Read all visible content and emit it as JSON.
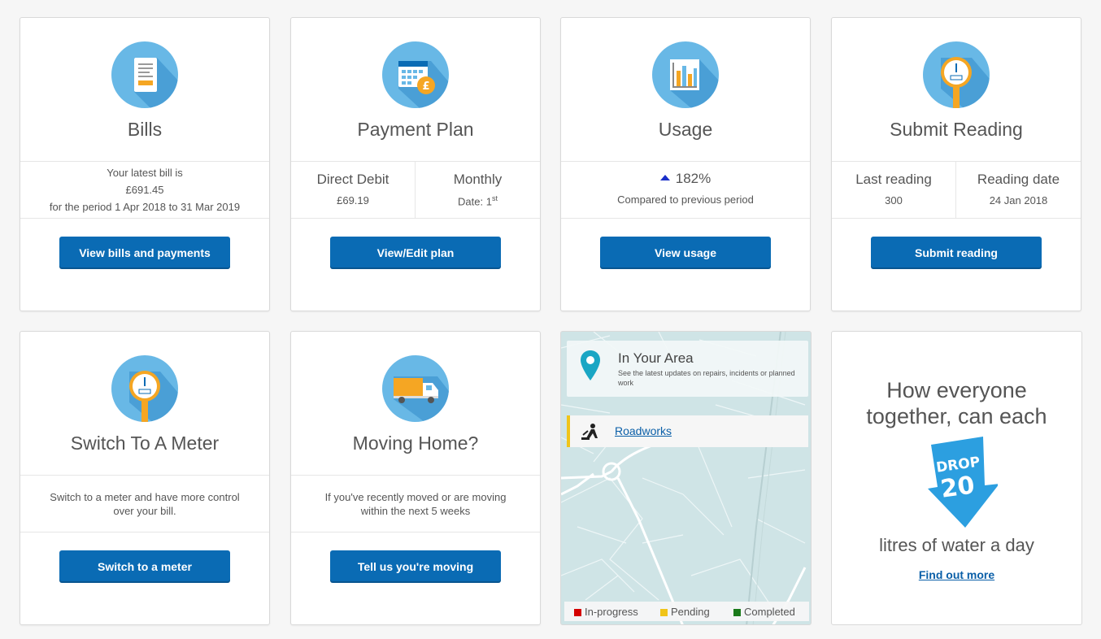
{
  "cards": {
    "bills": {
      "title": "Bills",
      "line1": "Your latest bill is",
      "amount": "£691.45",
      "period": "for the period 1 Apr 2018 to 31 Mar 2019",
      "button": "View bills and payments"
    },
    "payment_plan": {
      "title": "Payment Plan",
      "method_label": "Direct Debit",
      "method_value": "£69.19",
      "frequency_label": "Monthly",
      "frequency_value": "Date: 1",
      "frequency_suffix": "st",
      "button": "View/Edit plan"
    },
    "usage": {
      "title": "Usage",
      "percent": "182%",
      "comparison": "Compared to previous period",
      "button": "View usage",
      "trend_color": "#1a2fc9"
    },
    "submit_reading": {
      "title": "Submit Reading",
      "last_label": "Last reading",
      "last_value": "300",
      "date_label": "Reading date",
      "date_value": "24 Jan 2018",
      "button": "Submit reading"
    },
    "meter": {
      "title": "Switch To A Meter",
      "line1": "Switch to a meter and have more control",
      "line2": "over your bill.",
      "button": "Switch to a meter"
    },
    "moving": {
      "title": "Moving Home?",
      "line1": "If you've recently moved or are moving",
      "line2": "within the next 5 weeks",
      "button": "Tell us you're moving"
    }
  },
  "area": {
    "title": "In Your Area",
    "description": "See the latest updates on repairs, incidents or planned work",
    "roadworks": "Roadworks",
    "legend": [
      {
        "label": "In-progress",
        "color": "#d40000"
      },
      {
        "label": "Pending",
        "color": "#f0c419"
      },
      {
        "label": "Completed",
        "color": "#1a7a1a"
      }
    ]
  },
  "promo": {
    "heading": "How everyone together, can each",
    "badge_top": "DROP",
    "badge_number": "20",
    "litres": "litres of water a day",
    "link": "Find out more"
  },
  "colors": {
    "primary": "#0a6bb4",
    "icon_bg": "#68b8e6",
    "icon_shadow": "#4a9fd6"
  }
}
